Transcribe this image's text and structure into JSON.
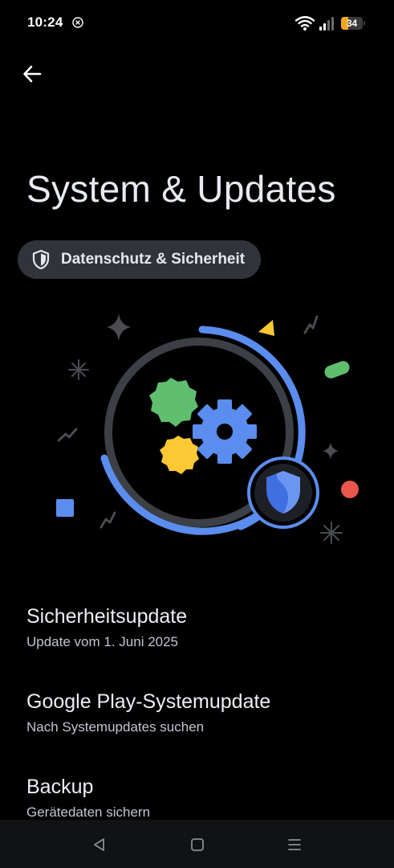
{
  "status_bar": {
    "time": "10:24",
    "battery_level": "34",
    "battery_fraction": 0.34,
    "battery_color": "#f2a81d",
    "icons": [
      "notification-dismiss-icon",
      "wifi-icon",
      "signal-icon",
      "battery-icon"
    ]
  },
  "header": {
    "back_icon": "arrow-left-icon",
    "title": "System & Updates"
  },
  "chip": {
    "icon": "shield-icon",
    "label": "Datenschutz & Sicherheit"
  },
  "illustration": {
    "ring_color": "#5b8def",
    "gear_colors": [
      "#5fbf6f",
      "#fbc934",
      "#5b8def"
    ],
    "badge_icon": "shield-icon"
  },
  "items": [
    {
      "title": "Sicherheitsupdate",
      "subtitle": "Update vom 1. Juni 2025"
    },
    {
      "title": "Google Play-Systemupdate",
      "subtitle": "Nach Systemupdates suchen"
    },
    {
      "title": "Backup",
      "subtitle": "Gerätedaten sichern"
    }
  ],
  "nav_bar": {
    "buttons": [
      "back-triangle-icon",
      "home-square-icon",
      "menu-lines-icon"
    ]
  }
}
